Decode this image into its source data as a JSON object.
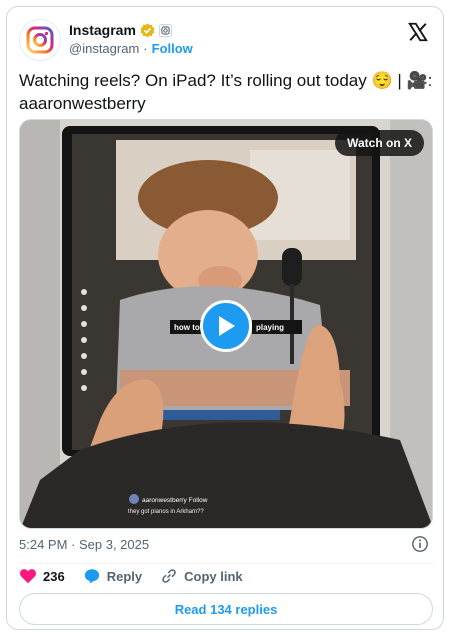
{
  "author": {
    "name": "Instagram",
    "handle": "@instagram",
    "separator": "·",
    "follow_label": "Follow"
  },
  "tweet": {
    "text": "Watching reels? On iPad? It’s rolling out today 😌 | 🎥: aaaronwestberry"
  },
  "media": {
    "watch_label": "Watch on X",
    "caption_left": "how to",
    "caption_right": "playing",
    "profile_line": "aaronwestberry  Follow",
    "profile_sub": "they got pianos in Arkham??"
  },
  "meta": {
    "timestamp": "5:24 PM · Sep 3, 2025"
  },
  "actions": {
    "likes": "236",
    "reply_label": "Reply",
    "copy_label": "Copy link"
  },
  "replies_label": "Read 134 replies",
  "colors": {
    "accent": "#1d9bf0",
    "like": "#f91880",
    "verified": "#e2b719"
  }
}
